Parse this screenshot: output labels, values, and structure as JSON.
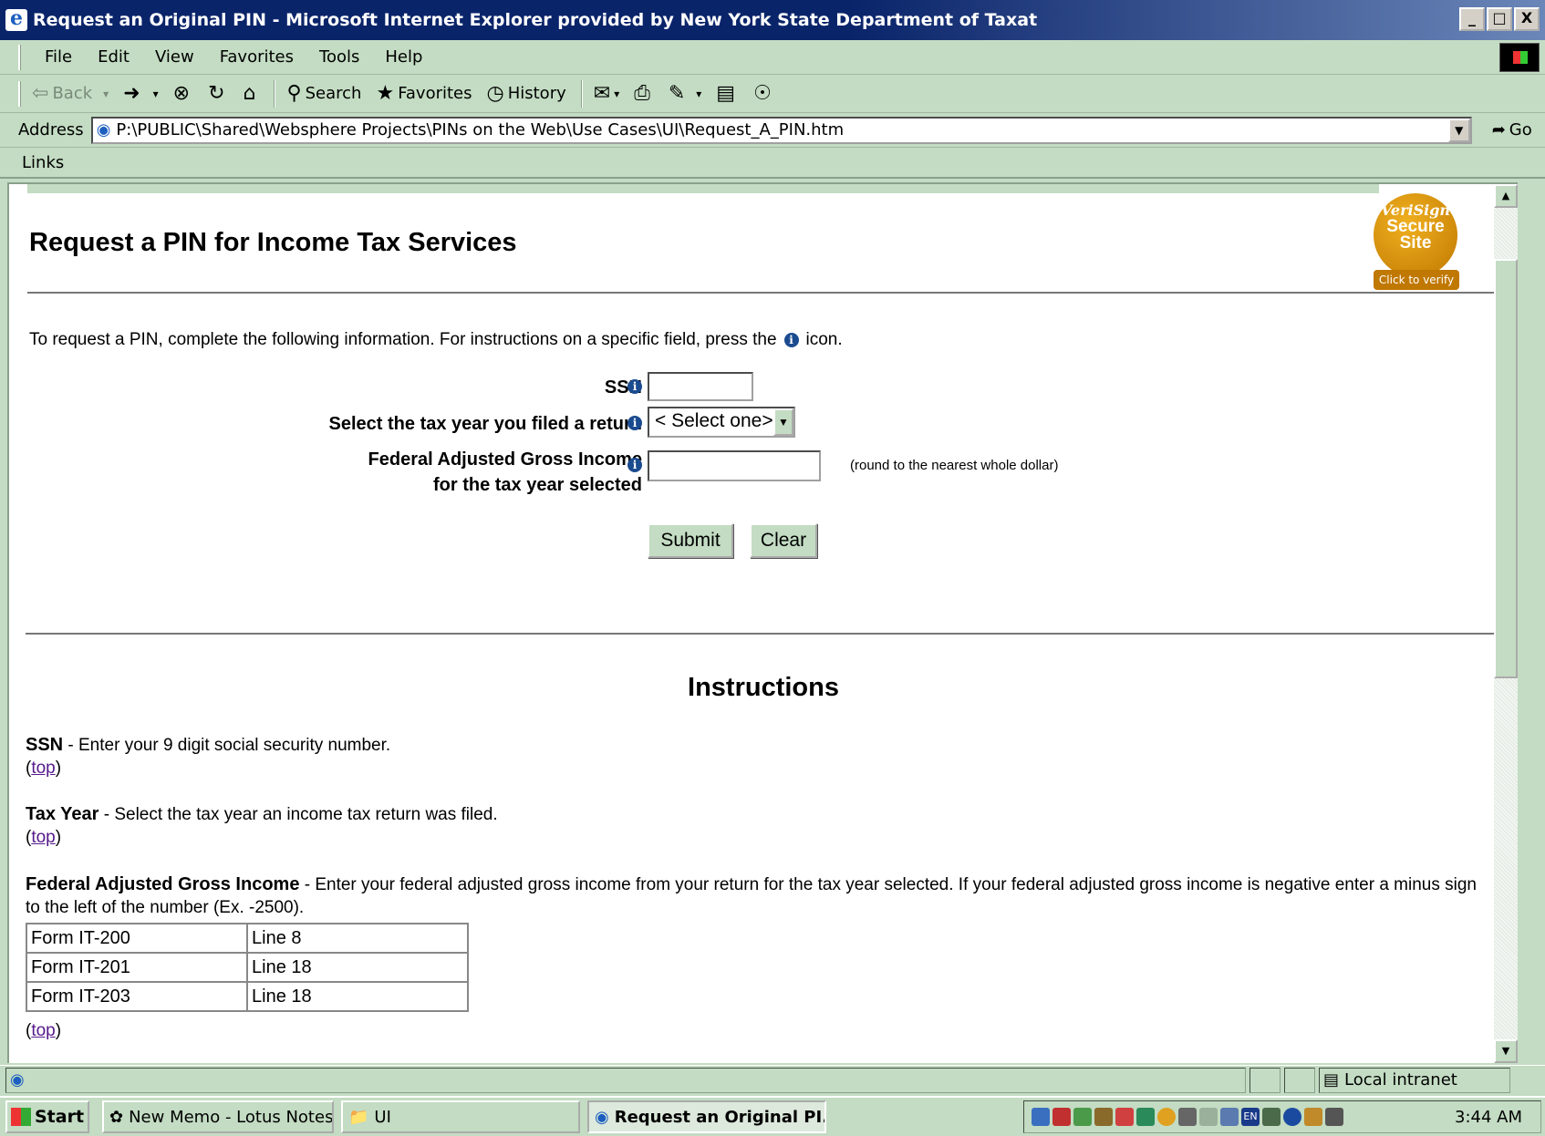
{
  "window": {
    "title": "Request an Original PIN - Microsoft Internet Explorer provided by New York State Department of Taxat",
    "buttons": [
      "_",
      "□",
      "X"
    ]
  },
  "menubar": [
    "File",
    "Edit",
    "View",
    "Favorites",
    "Tools",
    "Help"
  ],
  "toolbar": {
    "back": "Back",
    "search": "Search",
    "favorites": "Favorites",
    "history": "History"
  },
  "address": {
    "label": "Address",
    "url": "P:\\PUBLIC\\Shared\\Websphere Projects\\PINs on the Web\\Use Cases\\UI\\Request_A_PIN.htm",
    "go": "Go"
  },
  "links_label": "Links",
  "page": {
    "title": "Request a PIN for Income Tax Services",
    "seal": {
      "line1": "VeriSign",
      "line2": "Secure",
      "line3": "Site",
      "verify": "Click to verify"
    },
    "intro_before": "To request a PIN, complete the following information.  For instructions on a specific field, press the",
    "intro_after": "icon.",
    "form": {
      "ssn_label": "SSN",
      "taxyear_label": "Select the tax year you filed a return",
      "taxyear_value": "< Select one>",
      "agi_label_line1": "Federal Adjusted Gross Income",
      "agi_label_line2": "for the tax year selected",
      "agi_hint": "(round to the nearest whole dollar)",
      "submit": "Submit",
      "clear": "Clear"
    },
    "instructions_title": "Instructions",
    "instructions": {
      "ssn_term": "SSN",
      "ssn_text": " - Enter your 9 digit social security number.",
      "taxyear_term": "Tax Year",
      "taxyear_text": " - Select the tax year an income tax return was filed.",
      "agi_term": "Federal Adjusted Gross Income",
      "agi_text": " - Enter your federal adjusted gross income from your return for the tax year selected. If your federal adjusted gross income is negative enter a minus sign to the left of the number (Ex. -2500).",
      "top_link": "top"
    },
    "form_lines": [
      {
        "form": "Form IT-200",
        "line": "Line 8"
      },
      {
        "form": "Form IT-201",
        "line": "Line 18"
      },
      {
        "form": "Form IT-203",
        "line": "Line 18"
      }
    ]
  },
  "status": {
    "zone": "Local intranet"
  },
  "taskbar": {
    "start": "Start",
    "tasks": [
      "New Memo - Lotus Notes",
      "UI",
      "Request an Original PI..."
    ],
    "clock": "3:44 AM"
  }
}
